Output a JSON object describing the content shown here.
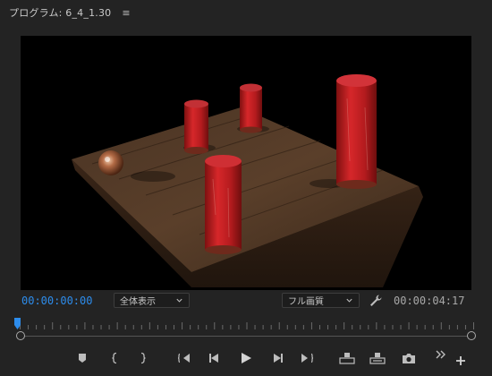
{
  "panel": {
    "title": "プログラム: 6_4_1.30",
    "menu_glyph": "≡"
  },
  "timecode": {
    "current": "00:00:00:00",
    "duration": "00:00:04:17"
  },
  "zoom_select": {
    "value": "全体表示"
  },
  "quality_select": {
    "value": "フル画質"
  },
  "colors": {
    "accent": "#2d8ceb",
    "panel_bg": "#232323",
    "viewer_bg": "#000000"
  },
  "transport": [
    {
      "id": "add-marker",
      "icon": "marker-icon"
    },
    {
      "id": "mark-in",
      "icon": "mark-in-icon"
    },
    {
      "id": "mark-out",
      "icon": "mark-out-icon"
    },
    {
      "id": "go-to-in",
      "icon": "go-to-in-icon"
    },
    {
      "id": "step-back",
      "icon": "step-back-icon"
    },
    {
      "id": "play",
      "icon": "play-icon"
    },
    {
      "id": "step-forward",
      "icon": "step-forward-icon"
    },
    {
      "id": "go-to-out",
      "icon": "go-to-out-icon"
    },
    {
      "id": "lift",
      "icon": "lift-icon"
    },
    {
      "id": "extract",
      "icon": "extract-icon"
    },
    {
      "id": "export-frame",
      "icon": "camera-icon"
    },
    {
      "id": "more",
      "icon": "chevron-double-right-icon"
    },
    {
      "id": "button-editor",
      "icon": "plus-icon"
    }
  ]
}
